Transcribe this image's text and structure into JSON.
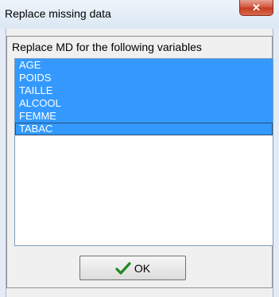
{
  "window": {
    "title": "Replace missing data",
    "close_icon": "close-icon"
  },
  "dialog": {
    "caption": "Replace MD for the following variables",
    "variables": [
      {
        "label": "AGE",
        "selected": true
      },
      {
        "label": "POIDS",
        "selected": true
      },
      {
        "label": "TAILLE",
        "selected": true
      },
      {
        "label": "ALCOOL",
        "selected": true
      },
      {
        "label": "FEMME",
        "selected": true
      },
      {
        "label": "TABAC",
        "selected": true,
        "focused": true
      }
    ],
    "ok_button": {
      "label": "OK",
      "icon": "check-icon"
    }
  },
  "colors": {
    "selection": "#3399ff",
    "check": "#1f8a1f",
    "close": "#c43b22"
  }
}
